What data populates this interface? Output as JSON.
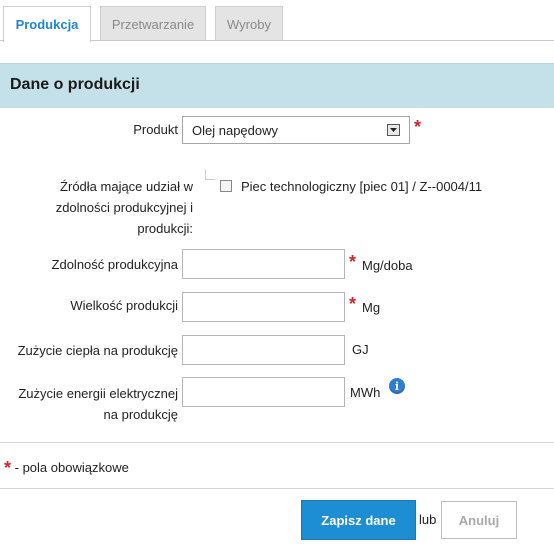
{
  "tabs": [
    {
      "label": "Produkcja",
      "active": true
    },
    {
      "label": "Przetwarzanie",
      "active": false
    },
    {
      "label": "Wyroby",
      "active": false
    }
  ],
  "section": {
    "title": "Dane o produkcji"
  },
  "form": {
    "product": {
      "label": "Produkt",
      "value": "Olej napędowy",
      "required_mark": "*"
    },
    "sources": {
      "label_lines": [
        "Źródła mające udział w",
        "zdolności produkcyjnej i",
        "produkcji:"
      ],
      "checkbox_label": "Piec technologiczny [piec 01] / Z--0004/11",
      "checked": false
    },
    "capacity": {
      "label": "Zdolność produkcyjna",
      "value": "",
      "unit": "Mg/doba",
      "required_mark": "*"
    },
    "production": {
      "label": "Wielkość produkcji",
      "value": "",
      "unit": "Mg",
      "required_mark": "*"
    },
    "heat": {
      "label": "Zużycie ciepła na produkcję",
      "value": "",
      "unit": "GJ"
    },
    "electricity": {
      "label_lines": [
        "Zużycie energii elektrycznej",
        "na produkcję"
      ],
      "value": "",
      "unit": "MWh",
      "info_icon": "info-icon"
    }
  },
  "required_note": {
    "mark": "*",
    "text": "- pola obowiązkowe"
  },
  "actions": {
    "save": "Zapisz dane",
    "or": "lub",
    "cancel": "Anuluj"
  },
  "colors": {
    "accent": "#1d8ed4",
    "section_bg": "#c4e1ea",
    "required": "#d0262d"
  }
}
